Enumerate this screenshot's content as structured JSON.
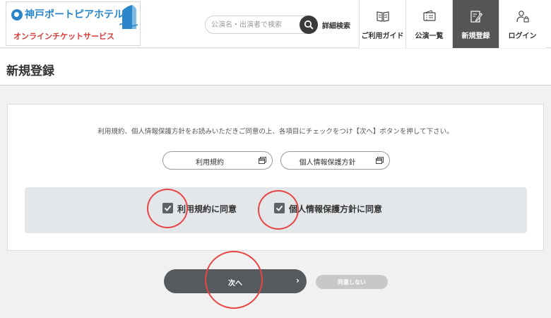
{
  "header": {
    "logo_name": "神戸ポートピアホテル",
    "logo_sub": "オンラインチケットサービス",
    "search_placeholder": "公演名・出演者で検索",
    "advanced_search": "詳細検索",
    "nav": [
      {
        "label": "ご利用ガイド",
        "icon": "book-icon"
      },
      {
        "label": "公演一覧",
        "icon": "ticket-icon"
      },
      {
        "label": "新規登録",
        "icon": "edit-icon",
        "active": true
      },
      {
        "label": "ログイン",
        "icon": "user-lock-icon"
      }
    ]
  },
  "page": {
    "title": "新規登録",
    "instruction": "利用規約、個人情報保護方針をお読みいただきご同意の上、各項目にチェックをつけ【次へ】ボタンを押して下さい。",
    "terms_button": "利用規約",
    "privacy_button": "個人情報保護方針",
    "agree_terms": "利用規約に同意",
    "agree_privacy": "個人情報保護方針に同意",
    "agree_terms_checked": true,
    "agree_privacy_checked": true,
    "next_button": "次へ",
    "decline_button": "同意しない"
  },
  "colors": {
    "brand_blue": "#2a86c9",
    "brand_red": "#d93a3a",
    "nav_active": "#555555",
    "annotation_red": "#e84545"
  }
}
